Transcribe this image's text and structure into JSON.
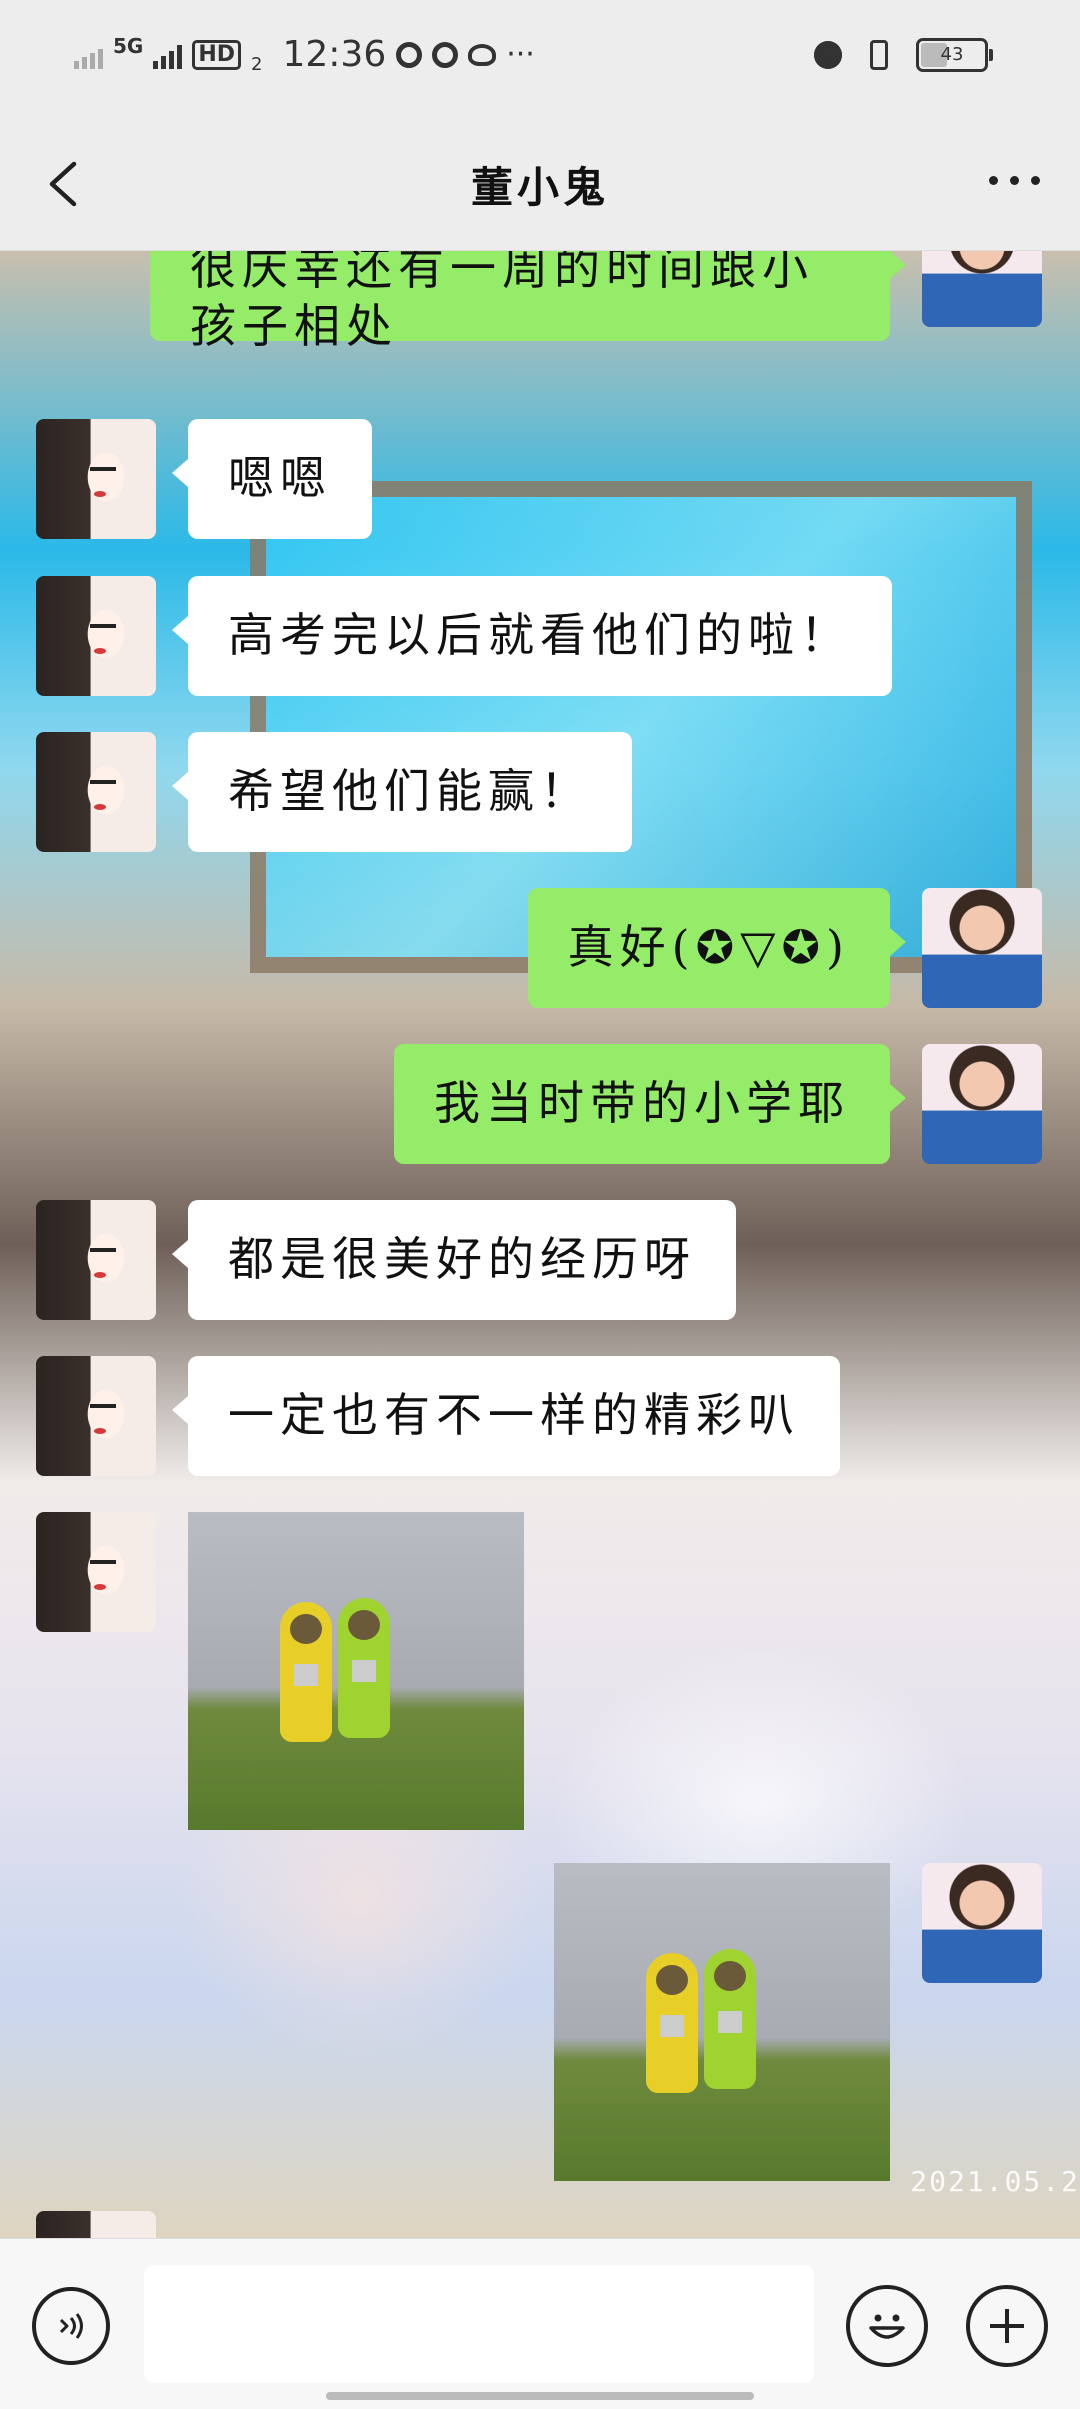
{
  "status_bar": {
    "network": "5G",
    "hd": "HD",
    "hd_sub": "2",
    "time": "12:36",
    "more": "···",
    "battery": "43"
  },
  "nav": {
    "title": "董小鬼"
  },
  "messages": [
    {
      "side": "right",
      "type": "text",
      "text_line1": "很庆幸还有一周的时间跟小",
      "text_line2": "孩子相处"
    },
    {
      "side": "left",
      "type": "text",
      "text": "嗯嗯"
    },
    {
      "side": "left",
      "type": "text",
      "text": "高考完以后就看他们的啦！"
    },
    {
      "side": "left",
      "type": "text",
      "text": "希望他们能赢！"
    },
    {
      "side": "right",
      "type": "text",
      "text": "真好(✪▽✪)"
    },
    {
      "side": "right",
      "type": "text",
      "text": "我当时带的小学耶"
    },
    {
      "side": "left",
      "type": "text",
      "text": "都是很美好的经历呀"
    },
    {
      "side": "left",
      "type": "text",
      "text": "一定也有不一样的精彩叭"
    },
    {
      "side": "left",
      "type": "sticker",
      "sticker": "teletubbies"
    },
    {
      "side": "right",
      "type": "sticker",
      "sticker": "teletubbies"
    }
  ],
  "background_stamp": "2021.05.2",
  "colors": {
    "bubble_green": "#95ec69",
    "bubble_white": "#ffffff",
    "bar_bg": "#ededed"
  },
  "icons": {
    "back": "chevron-left-icon",
    "more": "more-dots-icon",
    "voice": "voice-icon",
    "emoji": "emoji-icon",
    "plus": "plus-icon"
  }
}
